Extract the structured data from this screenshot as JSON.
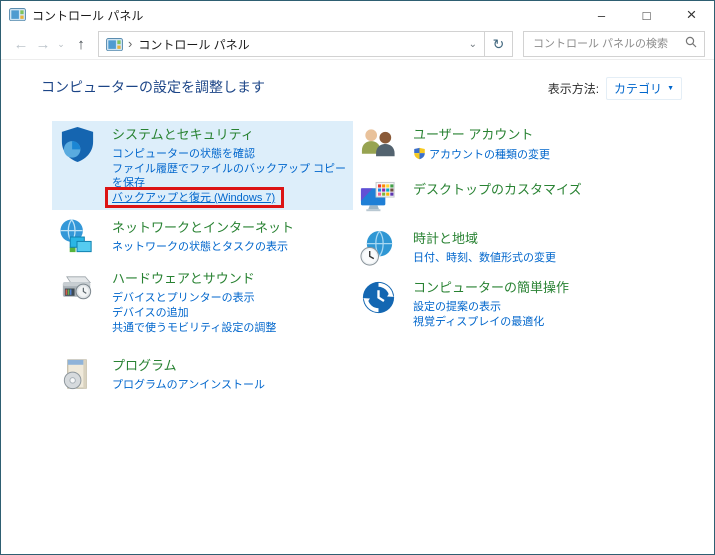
{
  "window": {
    "title": "コントロール パネル",
    "app_icon": "control-panel-icon"
  },
  "icons": {
    "back": "←",
    "forward": "→",
    "history_chevron": "⌄",
    "up": "↑",
    "address_chevron": "⌄",
    "refresh": "↻",
    "breadcrumb_separator": "›",
    "minimize": "–",
    "maximize": "□",
    "close": "×",
    "view_dropdown_arrow": "▼"
  },
  "navbar": {
    "breadcrumb_root": "コントロール パネル",
    "search_placeholder": "コントロール パネルの検索"
  },
  "header": {
    "title": "コンピューターの設定を調整します",
    "view_by_label": "表示方法:",
    "view_by_value": "カテゴリ"
  },
  "annotation": {
    "type": "red-highlight-box",
    "target": "バックアップと復元 (Windows 7)",
    "color": "#dc1414"
  },
  "colors": {
    "category_title_green": "#288232",
    "task_link_blue": "#0066cc",
    "page_title_blue": "#1c4587",
    "hover_background": "#ddeefa",
    "window_border": "#2e5f72",
    "annotation_red": "#dc1414"
  },
  "categories": {
    "left": [
      {
        "id": "system-security",
        "title": "システムとセキュリティ",
        "icon": "security-shield-icon",
        "hover": true,
        "links": [
          {
            "label": "コンピューターの状態を確認"
          },
          {
            "label": "ファイル履歴でファイルのバックアップ コピーを保存"
          },
          {
            "label": "バックアップと復元 (Windows 7)",
            "highlighted": true
          }
        ]
      },
      {
        "id": "network-internet",
        "title": "ネットワークとインターネット",
        "icon": "network-globe-icon",
        "links": [
          {
            "label": "ネットワークの状態とタスクの表示"
          }
        ]
      },
      {
        "id": "hardware-sound",
        "title": "ハードウェアとサウンド",
        "icon": "printer-icon",
        "links": [
          {
            "label": "デバイスとプリンターの表示"
          },
          {
            "label": "デバイスの追加"
          },
          {
            "label": "共通で使うモビリティ設定の調整"
          }
        ]
      },
      {
        "id": "programs",
        "title": "プログラム",
        "icon": "program-box-icon",
        "links": [
          {
            "label": "プログラムのアンインストール"
          }
        ]
      }
    ],
    "right": [
      {
        "id": "user-accounts",
        "title": "ユーザー アカウント",
        "icon": "users-icon",
        "links": [
          {
            "label": "アカウントの種類の変更",
            "uac_shield": true
          }
        ]
      },
      {
        "id": "appearance-personalization",
        "title": "デスクトップのカスタマイズ",
        "icon": "desktop-customize-icon",
        "links": []
      },
      {
        "id": "clock-region",
        "title": "時計と地域",
        "icon": "clock-globe-icon",
        "links": [
          {
            "label": "日付、時刻、数値形式の変更"
          }
        ]
      },
      {
        "id": "ease-of-access",
        "title": "コンピューターの簡単操作",
        "icon": "ease-of-access-icon",
        "links": [
          {
            "label": "設定の提案の表示"
          },
          {
            "label": "視覚ディスプレイの最適化"
          }
        ]
      }
    ]
  }
}
